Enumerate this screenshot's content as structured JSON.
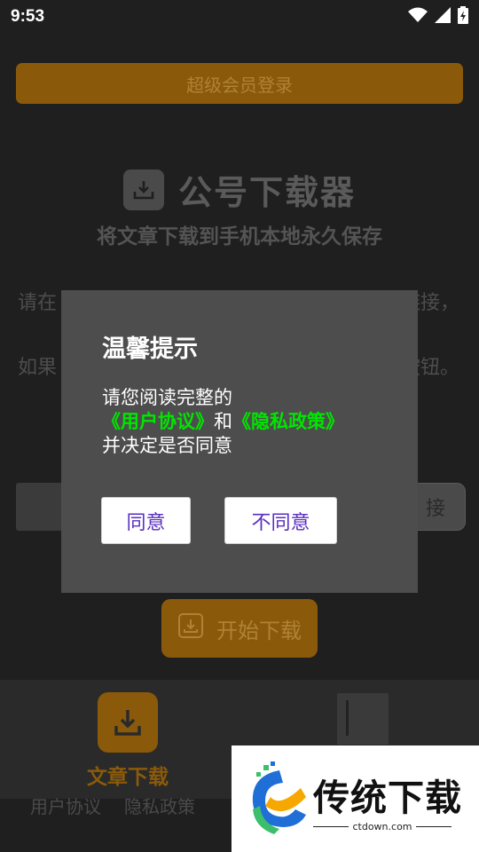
{
  "status_bar": {
    "time": "9:53"
  },
  "background_screen": {
    "vip_login_label": "超级会员登录",
    "app_title": "公号下载器",
    "app_subtitle": "将文章下载到手机本地永久保存",
    "description_line1_start": "请在",
    "description_line1_end": "链接，",
    "description_line2_start": "如果",
    "description_line2_end": "按钮。",
    "paste_button_label": "接",
    "start_download_label": "开始下载",
    "nav_articles_label": "文章下载",
    "footer_links": [
      "用户协议",
      "隐私政策"
    ]
  },
  "dialog": {
    "title": "温馨提示",
    "body_prefix": "请您阅读完整的",
    "user_agreement_link": "《用户协议》",
    "conjunction": "和",
    "privacy_policy_link": "《隐私政策》",
    "body_suffix": "并决定是否同意",
    "agree_label": "同意",
    "disagree_label": "不同意"
  },
  "watermark": {
    "brand_text": "传统下载",
    "url": "ctdown.com"
  },
  "colors": {
    "accent_dimmed": "#8a5a0a",
    "link_green": "#00e600",
    "button_text_purple": "#5a2fc2",
    "dialog_bg": "#4d4d4d"
  },
  "icons": [
    "wifi-icon",
    "signal-icon",
    "battery-icon",
    "download-icon"
  ]
}
